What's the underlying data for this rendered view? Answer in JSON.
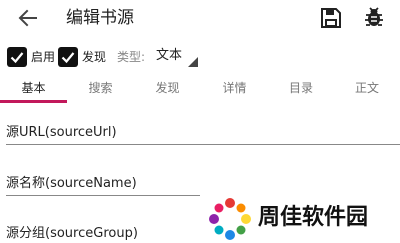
{
  "toolbar": {
    "title": "编辑书源",
    "back_icon": "arrow-left-icon",
    "save_icon": "save-icon",
    "debug_icon": "bug-icon"
  },
  "options": {
    "enable_label": "启用",
    "enable_checked": true,
    "discover_label": "发现",
    "discover_checked": true,
    "type_label": "类型:",
    "type_value": "文本"
  },
  "tabs": [
    {
      "label": "基本",
      "active": true
    },
    {
      "label": "搜索",
      "active": false
    },
    {
      "label": "发现",
      "active": false
    },
    {
      "label": "详情",
      "active": false
    },
    {
      "label": "目录",
      "active": false
    },
    {
      "label": "正文",
      "active": false
    }
  ],
  "fields": [
    {
      "label": "源URL(sourceUrl)"
    },
    {
      "label": "源名称(sourceName)"
    },
    {
      "label": "源分组(sourceGroup)"
    }
  ],
  "watermark": {
    "text": "周佳软件园",
    "colors": [
      "#e53935",
      "#43a047",
      "#1e88e5",
      "#fdd835"
    ]
  },
  "colors": {
    "accent": "#c2185b",
    "text": "#222222",
    "muted": "#777777"
  }
}
